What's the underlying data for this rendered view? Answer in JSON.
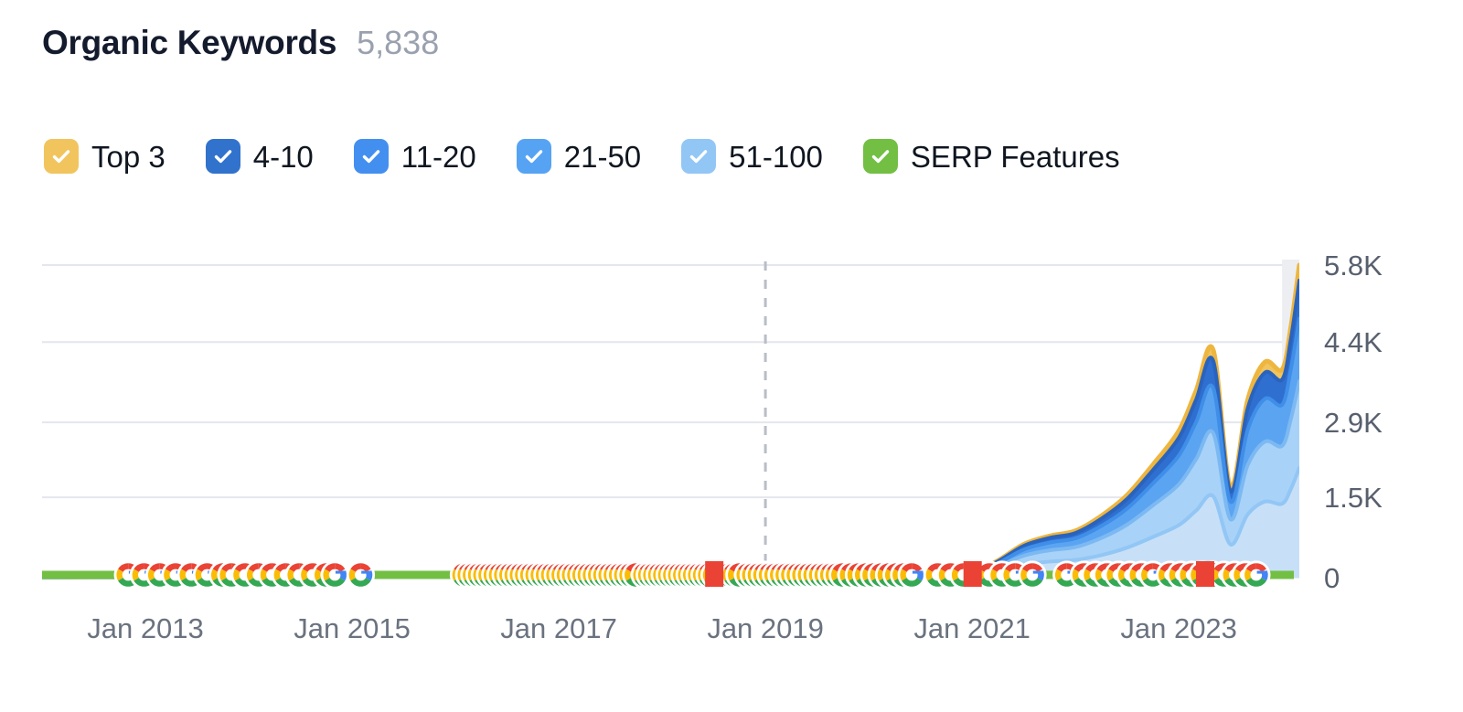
{
  "header": {
    "title": "Organic Keywords",
    "value": "5,838"
  },
  "legend": {
    "items": [
      {
        "label": "Top 3",
        "color": "#f1c45e",
        "checked": true,
        "name": "top-3"
      },
      {
        "label": "4-10",
        "color": "#3172cd",
        "checked": true,
        "name": "4-10"
      },
      {
        "label": "11-20",
        "color": "#438ff0",
        "checked": true,
        "name": "11-20"
      },
      {
        "label": "21-50",
        "color": "#56a3f4",
        "checked": true,
        "name": "21-50"
      },
      {
        "label": "51-100",
        "color": "#92c6f5",
        "checked": true,
        "name": "51-100"
      },
      {
        "label": "SERP Features",
        "color": "#72bf44",
        "checked": true,
        "name": "serp-features"
      }
    ]
  },
  "chart_data": {
    "type": "area",
    "title": "Organic Keywords",
    "stacked": true,
    "xlabel": "",
    "ylabel": "",
    "grid": true,
    "legend_position": "top",
    "ylim": [
      0,
      5838
    ],
    "ytick_labels": [
      "5.8K",
      "4.4K",
      "2.9K",
      "1.5K",
      "0"
    ],
    "ytick_values": [
      5838,
      4400,
      2900,
      1500,
      0
    ],
    "xtick_labels": [
      "Jan 2013",
      "Jan 2015",
      "Jan 2017",
      "Jan 2019",
      "Jan 2021",
      "Jan 2023"
    ],
    "xtick_values": [
      "2013-01",
      "2015-01",
      "2017-01",
      "2019-01",
      "2021-01",
      "2023-01"
    ],
    "x_range": [
      "2012-01",
      "2024-03"
    ],
    "annotations": [
      {
        "type": "vertical-dashed-line",
        "x": "2019-01",
        "color": "#b9bdc7"
      },
      {
        "type": "shaded-region",
        "x_start": "2024-01",
        "x_end": "2024-03",
        "color": "#eceef2",
        "label": "current period"
      }
    ],
    "markers": {
      "name": "google-algorithm-updates",
      "icon": "google-g-icon",
      "description": "Google algorithm update markers along the baseline"
    },
    "series": [
      {
        "name": "51-100",
        "color": "#c7e0f7",
        "line_color": "#92c6f5",
        "x": [
          "2012-01",
          "2012-07",
          "2013-01",
          "2013-07",
          "2014-01",
          "2014-07",
          "2015-01",
          "2015-07",
          "2016-01",
          "2016-07",
          "2017-01",
          "2017-07",
          "2018-01",
          "2018-07",
          "2019-01",
          "2019-07",
          "2020-01",
          "2020-07",
          "2021-01",
          "2021-04",
          "2021-07",
          "2021-10",
          "2022-01",
          "2022-04",
          "2022-07",
          "2022-10",
          "2023-01",
          "2023-03",
          "2023-05",
          "2023-07",
          "2023-09",
          "2023-11",
          "2024-01",
          "2024-02",
          "2024-03"
        ],
        "values": [
          3,
          4,
          5,
          6,
          6,
          7,
          8,
          9,
          10,
          11,
          12,
          12,
          14,
          15,
          16,
          18,
          20,
          25,
          38,
          120,
          240,
          300,
          330,
          420,
          560,
          760,
          980,
          1250,
          1520,
          620,
          1180,
          1420,
          1380,
          1650,
          2050
        ]
      },
      {
        "name": "21-50",
        "color": "#a8d2f7",
        "line_color": "#7cb9f2",
        "x": [
          "2012-01",
          "2012-07",
          "2013-01",
          "2013-07",
          "2014-01",
          "2014-07",
          "2015-01",
          "2015-07",
          "2016-01",
          "2016-07",
          "2017-01",
          "2017-07",
          "2018-01",
          "2018-07",
          "2019-01",
          "2019-07",
          "2020-01",
          "2020-07",
          "2021-01",
          "2021-04",
          "2021-07",
          "2021-10",
          "2022-01",
          "2022-04",
          "2022-07",
          "2022-10",
          "2023-01",
          "2023-03",
          "2023-05",
          "2023-07",
          "2023-09",
          "2023-11",
          "2024-01",
          "2024-02",
          "2024-03"
        ],
        "values": [
          2,
          3,
          3,
          4,
          4,
          5,
          5,
          6,
          6,
          7,
          8,
          8,
          9,
          10,
          11,
          12,
          14,
          18,
          26,
          90,
          170,
          210,
          240,
          320,
          430,
          590,
          760,
          960,
          1180,
          470,
          920,
          1120,
          1080,
          1300,
          1620
        ]
      },
      {
        "name": "11-20",
        "color": "#5ba4f2",
        "line_color": "#3f8ee8",
        "x": [
          "2012-01",
          "2012-07",
          "2013-01",
          "2013-07",
          "2014-01",
          "2014-07",
          "2015-01",
          "2015-07",
          "2016-01",
          "2016-07",
          "2017-01",
          "2017-07",
          "2018-01",
          "2018-07",
          "2019-01",
          "2019-07",
          "2020-01",
          "2020-07",
          "2021-01",
          "2021-04",
          "2021-07",
          "2021-10",
          "2022-01",
          "2022-04",
          "2022-07",
          "2022-10",
          "2023-01",
          "2023-03",
          "2023-05",
          "2023-07",
          "2023-09",
          "2023-11",
          "2024-01",
          "2024-02",
          "2024-03"
        ],
        "values": [
          1,
          2,
          2,
          2,
          3,
          3,
          3,
          4,
          4,
          5,
          5,
          6,
          6,
          7,
          8,
          9,
          10,
          13,
          18,
          60,
          115,
          145,
          165,
          225,
          300,
          410,
          540,
          690,
          840,
          330,
          660,
          800,
          770,
          930,
          1170
        ]
      },
      {
        "name": "4-10",
        "color": "#2f6fd0",
        "line_color": "#2a63bd",
        "x": [
          "2012-01",
          "2012-07",
          "2013-01",
          "2013-07",
          "2014-01",
          "2014-07",
          "2015-01",
          "2015-07",
          "2016-01",
          "2016-07",
          "2017-01",
          "2017-07",
          "2018-01",
          "2018-07",
          "2019-01",
          "2019-07",
          "2020-01",
          "2020-07",
          "2021-01",
          "2021-04",
          "2021-07",
          "2021-10",
          "2022-01",
          "2022-04",
          "2022-07",
          "2022-10",
          "2023-01",
          "2023-03",
          "2023-05",
          "2023-07",
          "2023-09",
          "2023-11",
          "2024-01",
          "2024-02",
          "2024-03"
        ],
        "values": [
          1,
          1,
          1,
          1,
          1,
          2,
          2,
          2,
          2,
          3,
          3,
          3,
          4,
          4,
          5,
          5,
          6,
          8,
          11,
          35,
          70,
          88,
          100,
          135,
          180,
          250,
          330,
          420,
          510,
          200,
          400,
          490,
          470,
          560,
          710
        ]
      },
      {
        "name": "Top 3",
        "color": "#f1c45e",
        "line_color": "#eeb63f",
        "x": [
          "2012-01",
          "2012-07",
          "2013-01",
          "2013-07",
          "2014-01",
          "2014-07",
          "2015-01",
          "2015-07",
          "2016-01",
          "2016-07",
          "2017-01",
          "2017-07",
          "2018-01",
          "2018-07",
          "2019-01",
          "2019-07",
          "2020-01",
          "2020-07",
          "2021-01",
          "2021-04",
          "2021-07",
          "2021-10",
          "2022-01",
          "2022-04",
          "2022-07",
          "2022-10",
          "2023-01",
          "2023-03",
          "2023-05",
          "2023-07",
          "2023-09",
          "2023-11",
          "2024-01",
          "2024-02",
          "2024-03"
        ],
        "values": [
          0,
          0,
          1,
          1,
          1,
          1,
          1,
          1,
          1,
          1,
          1,
          2,
          2,
          2,
          2,
          3,
          3,
          4,
          5,
          14,
          28,
          35,
          40,
          54,
          72,
          100,
          132,
          168,
          204,
          80,
          160,
          196,
          188,
          224,
          288
        ]
      },
      {
        "name": "SERP Features",
        "color": "#72bf44",
        "line_color": "#72bf44",
        "type": "line",
        "baseline": true,
        "x": [
          "2012-01",
          "2014-01",
          "2016-01",
          "2018-01",
          "2020-01",
          "2022-01",
          "2024-03"
        ],
        "values": [
          0,
          0,
          0,
          0,
          0,
          0,
          0
        ]
      }
    ]
  }
}
